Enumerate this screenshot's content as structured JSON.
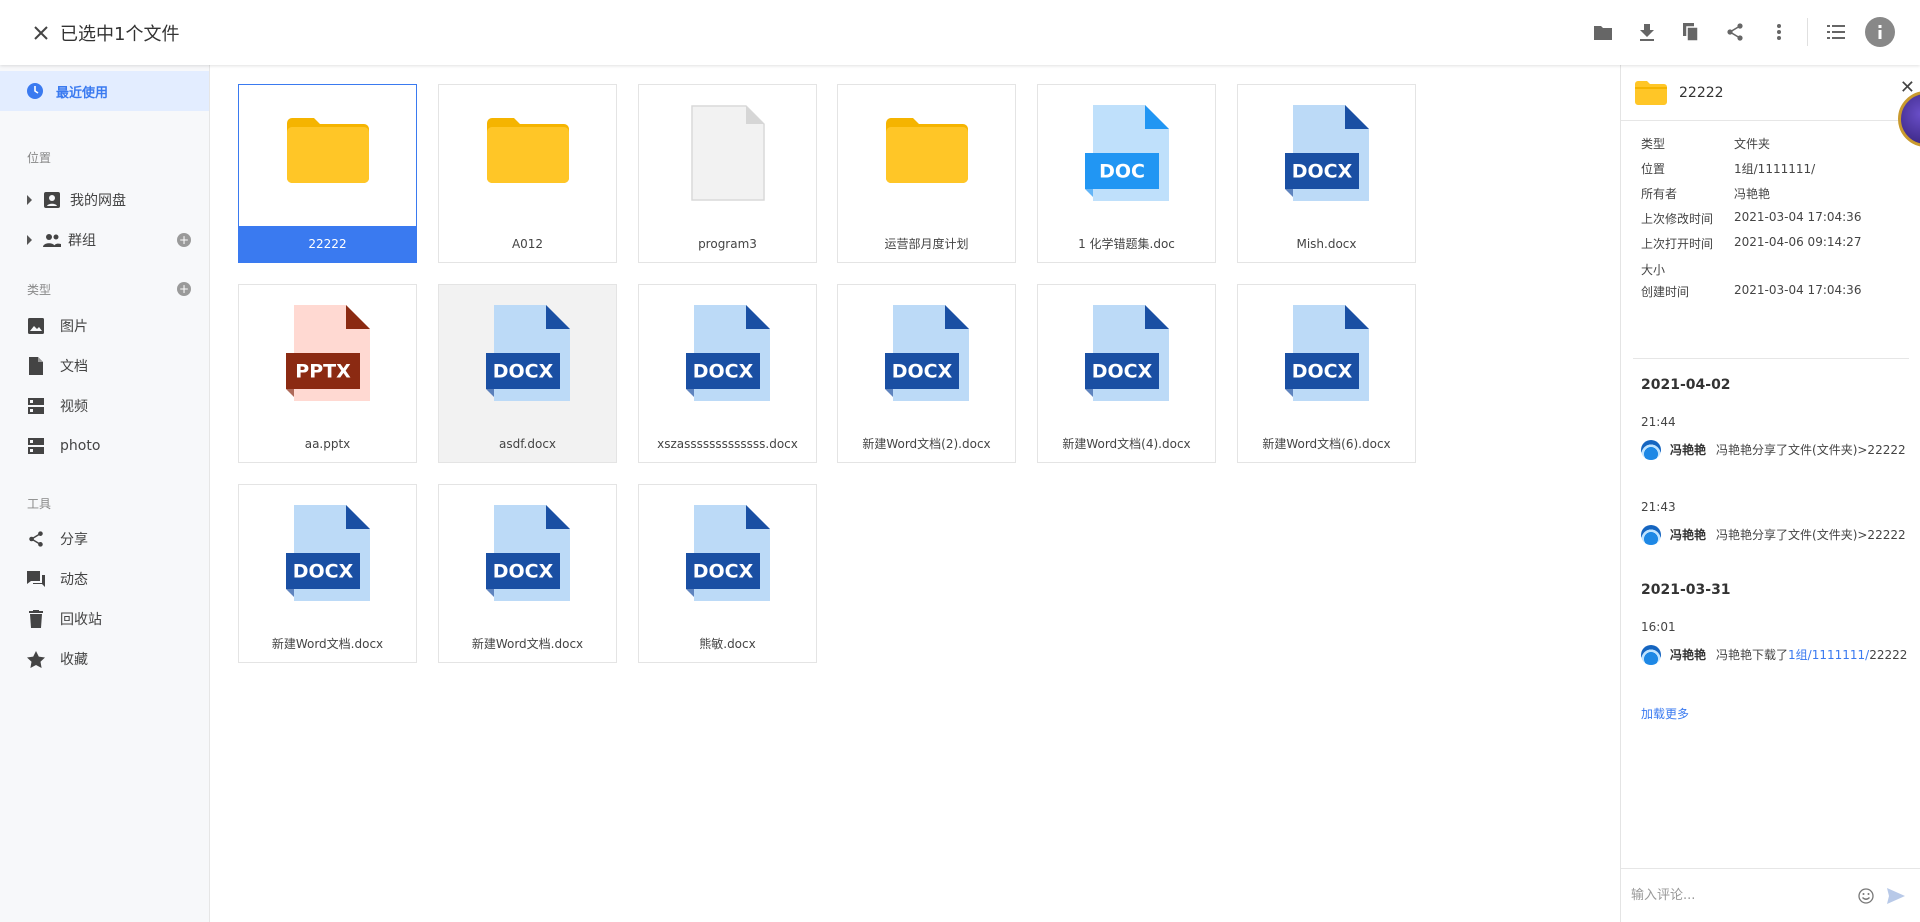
{
  "topbar": {
    "selection_title": "已选中1个文件"
  },
  "sidebar": {
    "recent": "最近使用",
    "location_label": "位置",
    "my_drive": "我的网盘",
    "groups": "群组",
    "type_label": "类型",
    "types": [
      "图片",
      "文档",
      "视频",
      "photo"
    ],
    "tools_label": "工具",
    "tools": [
      "分享",
      "动态",
      "回收站",
      "收藏"
    ]
  },
  "files": [
    {
      "name": "22222",
      "type": "folder",
      "selected": true
    },
    {
      "name": "A012",
      "type": "folder"
    },
    {
      "name": "program3",
      "type": "blank"
    },
    {
      "name": "运营部月度计划",
      "type": "folder"
    },
    {
      "name": "1 化学错题集.doc",
      "type": "doc",
      "badge": "DOC"
    },
    {
      "name": "Mish.docx",
      "type": "docx",
      "badge": "DOCX"
    },
    {
      "name": "aa.pptx",
      "type": "pptx",
      "badge": "PPTX"
    },
    {
      "name": "asdf.docx",
      "type": "docx",
      "badge": "DOCX",
      "hover": true
    },
    {
      "name": "xszasssssssssssss.docx",
      "type": "docx",
      "badge": "DOCX"
    },
    {
      "name": "新建Word文档(2).docx",
      "type": "docx",
      "badge": "DOCX"
    },
    {
      "name": "新建Word文档(4).docx",
      "type": "docx",
      "badge": "DOCX"
    },
    {
      "name": "新建Word文档(6).docx",
      "type": "docx",
      "badge": "DOCX"
    },
    {
      "name": "新建Word文档.docx",
      "type": "docx",
      "badge": "DOCX"
    },
    {
      "name": "新建Word文档.docx",
      "type": "docx",
      "badge": "DOCX"
    },
    {
      "name": "熊敏.docx",
      "type": "docx",
      "badge": "DOCX"
    }
  ],
  "details": {
    "name": "22222",
    "props": [
      {
        "k": "类型",
        "v": "文件夹"
      },
      {
        "k": "位置",
        "v": "1组/1111111/"
      },
      {
        "k": "所有者",
        "v": "冯艳艳"
      },
      {
        "k": "上次修改时间",
        "v": "2021-03-04 17:04:36"
      },
      {
        "k": "上次打开时间",
        "v": "2021-04-06 09:14:27"
      },
      {
        "k": "大小",
        "v": ""
      },
      {
        "k": "创建时间",
        "v": "2021-03-04 17:04:36"
      }
    ],
    "activity": {
      "date1": "2021-04-02",
      "time1": "21:44",
      "user1": "冯艳艳",
      "text1": "冯艳艳分享了文件(文件夹)>22222",
      "time2": "21:43",
      "user2": "冯艳艳",
      "text2": "冯艳艳分享了文件(文件夹)>22222",
      "date2": "2021-03-31",
      "time3": "16:01",
      "user3": "冯艳艳",
      "text3_prefix": "冯艳艳下载了",
      "text3_link": "1组/1111111/",
      "text3_suffix": "22222"
    },
    "load_more": "加载更多",
    "comment_placeholder": "输入评论..."
  },
  "colors": {
    "accent": "#3a7af0",
    "folder": "#ffc627",
    "docx_dark": "#1a4fa3",
    "doc_light": "#2196f3",
    "pptx": "#8b2a12"
  }
}
